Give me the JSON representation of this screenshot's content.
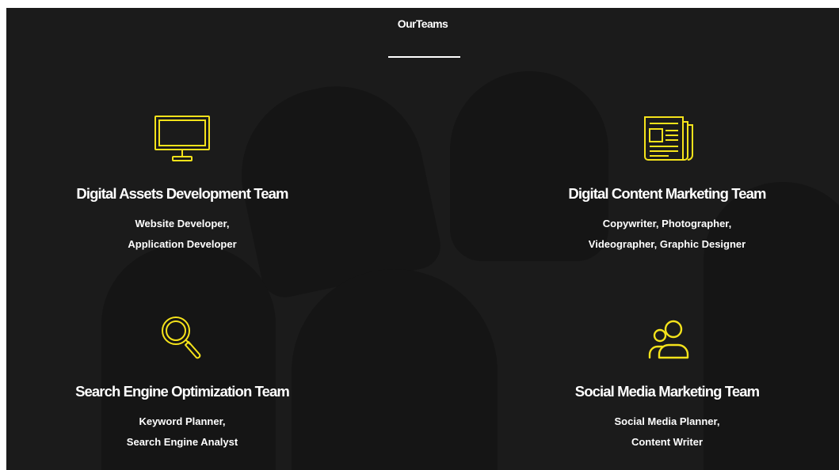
{
  "section": {
    "title": "OurTeams"
  },
  "colors": {
    "background": "#1b1b1b",
    "accent_icon": "#f5e31b",
    "text": "#ffffff"
  },
  "teams": [
    {
      "icon": "monitor-icon",
      "name": "Digital Assets Development Team",
      "roles": [
        "Website Developer,",
        "Application Developer"
      ]
    },
    {
      "icon": "newspaper-icon",
      "name": "Digital Content Marketing Team",
      "roles": [
        "Copywriter, Photographer,",
        "Videographer, Graphic Designer"
      ]
    },
    {
      "icon": "magnifier-icon",
      "name": "Search Engine Optimization Team",
      "roles": [
        "Keyword Planner,",
        "Search Engine Analyst"
      ]
    },
    {
      "icon": "users-icon",
      "name": "Social Media Marketing Team",
      "roles": [
        "Social Media Planner,",
        "Content Writer"
      ]
    }
  ]
}
